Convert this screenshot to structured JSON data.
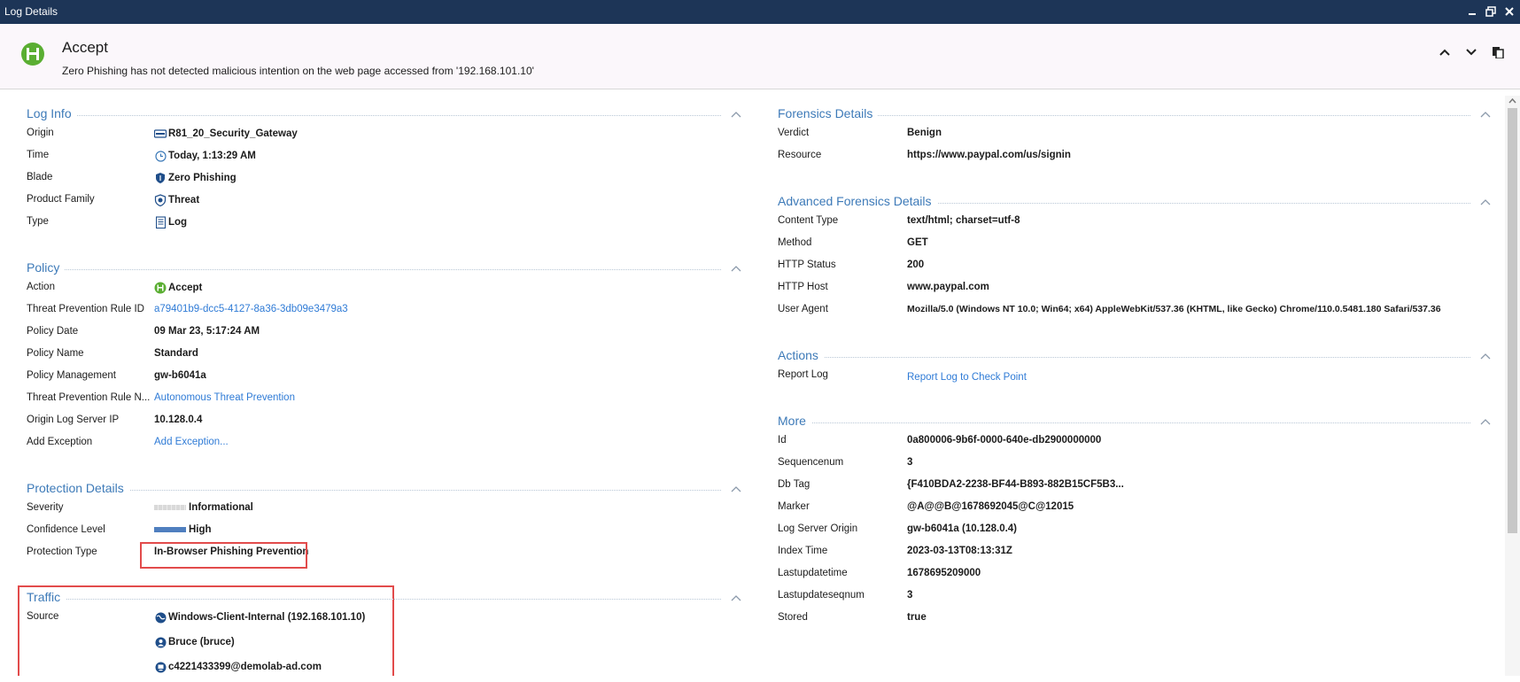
{
  "window": {
    "title": "Log Details"
  },
  "header": {
    "action": "Accept",
    "description": "Zero Phishing has not detected malicious intention on the web page accessed from '192.168.101.10'"
  },
  "log_info": {
    "title": "Log Info",
    "rows": [
      {
        "label": "Origin",
        "value": "R81_20_Security_Gateway",
        "icon": "gateway-icon"
      },
      {
        "label": "Time",
        "value": "Today, 1:13:29 AM",
        "icon": "clock-icon"
      },
      {
        "label": "Blade",
        "value": "Zero Phishing",
        "icon": "shield-icon"
      },
      {
        "label": "Product Family",
        "value": "Threat",
        "icon": "threat-icon"
      },
      {
        "label": "Type",
        "value": "Log",
        "icon": "document-icon"
      }
    ]
  },
  "policy": {
    "title": "Policy",
    "rows": [
      {
        "label": "Action",
        "value": "Accept"
      },
      {
        "label": "Threat Prevention Rule ID",
        "value": "a79401b9-dcc5-4127-8a36-3db09e3479a3"
      },
      {
        "label": "Policy Date",
        "value": "09 Mar 23, 5:17:24 AM"
      },
      {
        "label": "Policy Name",
        "value": "Standard"
      },
      {
        "label": "Policy Management",
        "value": "gw-b6041a"
      },
      {
        "label": "Threat Prevention Rule N...",
        "value": "Autonomous Threat Prevention"
      },
      {
        "label": "Origin Log Server IP",
        "value": "10.128.0.4"
      },
      {
        "label": "Add Exception",
        "value": "Add Exception..."
      }
    ]
  },
  "protection": {
    "title": "Protection Details",
    "rows": [
      {
        "label": "Severity",
        "value": "Informational"
      },
      {
        "label": "Confidence Level",
        "value": "High"
      },
      {
        "label": "Protection Type",
        "value": "In-Browser Phishing Prevention"
      }
    ]
  },
  "traffic": {
    "title": "Traffic",
    "source_label": "Source",
    "source_host": "Windows-Client-Internal (192.168.101.10)",
    "source_user": "Bruce (bruce)",
    "source_machine": "c4221433399@demolab-ad.com"
  },
  "forensics": {
    "title": "Forensics Details",
    "rows": [
      {
        "label": "Verdict",
        "value": "Benign"
      },
      {
        "label": "Resource",
        "value": "https://www.paypal.com/us/signin"
      }
    ]
  },
  "advanced": {
    "title": "Advanced Forensics Details",
    "rows": [
      {
        "label": "Content Type",
        "value": "text/html; charset=utf-8"
      },
      {
        "label": "Method",
        "value": "GET"
      },
      {
        "label": "HTTP Status",
        "value": "200"
      },
      {
        "label": "HTTP Host",
        "value": "www.paypal.com"
      },
      {
        "label": "User Agent",
        "value": "Mozilla/5.0 (Windows NT 10.0; Win64; x64) AppleWebKit/537.36 (KHTML, like Gecko) Chrome/110.0.5481.180 Safari/537.36"
      }
    ]
  },
  "actions": {
    "title": "Actions",
    "rows": [
      {
        "label": "Report Log",
        "value": "Report Log to Check Point"
      }
    ]
  },
  "more": {
    "title": "More",
    "rows": [
      {
        "label": "Id",
        "value": "0a800006-9b6f-0000-640e-db2900000000"
      },
      {
        "label": "Sequencenum",
        "value": "3"
      },
      {
        "label": "Db Tag",
        "value": "{F410BDA2-2238-BF44-B893-882B15CF5B3..."
      },
      {
        "label": "Marker",
        "value": "@A@@B@1678692045@C@12015"
      },
      {
        "label": "Log Server Origin",
        "value": "gw-b6041a (10.128.0.4)"
      },
      {
        "label": "Index Time",
        "value": "2023-03-13T08:13:31Z"
      },
      {
        "label": "Lastupdatetime",
        "value": "1678695209000"
      },
      {
        "label": "Lastupdateseqnum",
        "value": "3"
      },
      {
        "label": "Stored",
        "value": "true"
      }
    ]
  },
  "colors": {
    "accent": "#3d7ab8",
    "link": "#2f7bd6",
    "accept_green": "#5aae32",
    "titlebar": "#1d3557",
    "highlight": "#e24b4b"
  }
}
